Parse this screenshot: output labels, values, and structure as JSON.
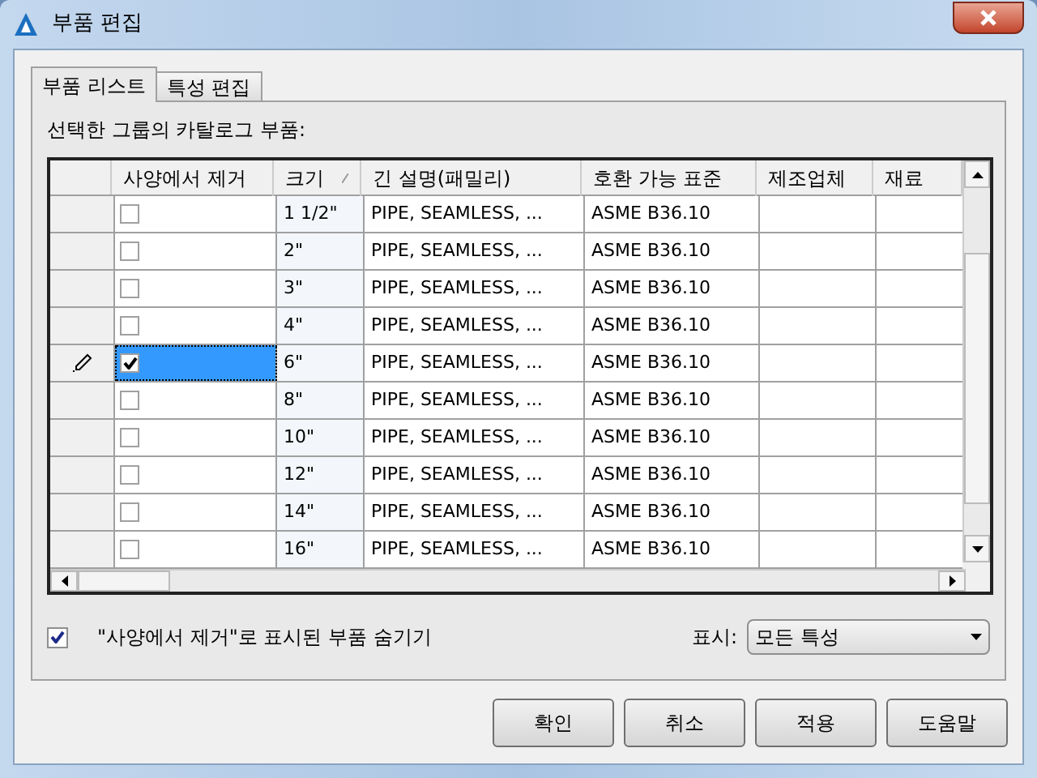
{
  "window": {
    "title": "부품 편집"
  },
  "tabs": [
    {
      "label": "부품 리스트",
      "selected": true
    },
    {
      "label": "특성 편집",
      "selected": false
    }
  ],
  "caption": "선택한 그룹의 카탈로그 부품:",
  "table": {
    "columns": [
      {
        "label": "사양에서 제거",
        "sorted": false
      },
      {
        "label": "크기",
        "sorted": true
      },
      {
        "label": "긴 설명(패밀리)",
        "sorted": false
      },
      {
        "label": "호환 가능 표준",
        "sorted": false
      },
      {
        "label": "제조업체",
        "sorted": false
      },
      {
        "label": "재료",
        "sorted": false
      }
    ],
    "rows": [
      {
        "removed": false,
        "selected": false,
        "size": "1 1/2\"",
        "description": "PIPE, SEAMLESS, ...",
        "standard": "ASME B36.10"
      },
      {
        "removed": false,
        "selected": false,
        "size": "2\"",
        "description": "PIPE, SEAMLESS, ...",
        "standard": "ASME B36.10"
      },
      {
        "removed": false,
        "selected": false,
        "size": "3\"",
        "description": "PIPE, SEAMLESS, ...",
        "standard": "ASME B36.10"
      },
      {
        "removed": false,
        "selected": false,
        "size": "4\"",
        "description": "PIPE, SEAMLESS, ...",
        "standard": "ASME B36.10"
      },
      {
        "removed": true,
        "selected": true,
        "size": "6\"",
        "description": "PIPE, SEAMLESS, ...",
        "standard": "ASME B36.10"
      },
      {
        "removed": false,
        "selected": false,
        "size": "8\"",
        "description": "PIPE, SEAMLESS, ...",
        "standard": "ASME B36.10"
      },
      {
        "removed": false,
        "selected": false,
        "size": "10\"",
        "description": "PIPE, SEAMLESS, ...",
        "standard": "ASME B36.10"
      },
      {
        "removed": false,
        "selected": false,
        "size": "12\"",
        "description": "PIPE, SEAMLESS, ...",
        "standard": "ASME B36.10"
      },
      {
        "removed": false,
        "selected": false,
        "size": "14\"",
        "description": "PIPE, SEAMLESS, ...",
        "standard": "ASME B36.10"
      },
      {
        "removed": false,
        "selected": false,
        "size": "16\"",
        "description": "PIPE, SEAMLESS, ...",
        "standard": "ASME B36.10"
      }
    ]
  },
  "hide_removed": {
    "label": "\"사양에서 제거\"로 표시된 부품 숨기기",
    "checked": true
  },
  "display": {
    "label": "표시:",
    "value": "모든 특성"
  },
  "buttons": [
    "확인",
    "취소",
    "적용",
    "도움말"
  ]
}
